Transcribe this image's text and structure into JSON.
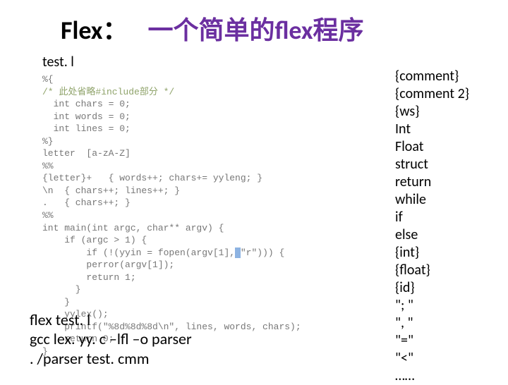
{
  "title": {
    "label": "Flex：",
    "main": "一个简单的flex程序"
  },
  "filename": "test. l",
  "code": {
    "l1": "%{",
    "l2": "/* 此处省略#include部分 */",
    "l3": "  int chars = 0;",
    "l4": "  int words = 0;",
    "l5": "  int lines = 0;",
    "l6": "%}",
    "l7": "letter  [a-zA-Z]",
    "l8": "%%",
    "l9": "{letter}+   { words++; chars+= yyleng; }",
    "l10": "\\n  { chars++; lines++; }",
    "l11": ".   { chars++; }",
    "l12": "%%",
    "l13": "int main(int argc, char** argv) {",
    "l14": "    if (argc > 1) {",
    "l15a": "        if (!(yyin = fopen(argv[1],",
    "l15b": " ",
    "l15c": "\"r\"))) {",
    "l16": "        perror(argv[1]);",
    "l17": "        return 1;",
    "l18": "      }",
    "l19": "    }",
    "l20": "    yylex();",
    "l21": "    printf(\"%8d%8d%8d\\n\", lines, words, chars);",
    "l22": "    return 0;",
    "l23": "}"
  },
  "cmds": {
    "l1": "flex test. l",
    "l2": "gcc  lex. yy. c –lfl –o parser",
    "l3": ". /parser test. cmm"
  },
  "tokens": {
    "t1": "{comment}",
    "t2": "{comment 2}",
    "t3": "{ws}",
    "t4": "Int",
    "t5": "Float",
    "t6": "struct",
    "t7": "return",
    "t8": "while",
    "t9": "if",
    "t10": "else",
    "t11": "{int}",
    "t12": "{float}",
    "t13": "{id}",
    "t14": "\"; \"",
    "t15": "\", \"",
    "t16": "\"=\"",
    "t17": "\"<\"",
    "t18": "……"
  }
}
